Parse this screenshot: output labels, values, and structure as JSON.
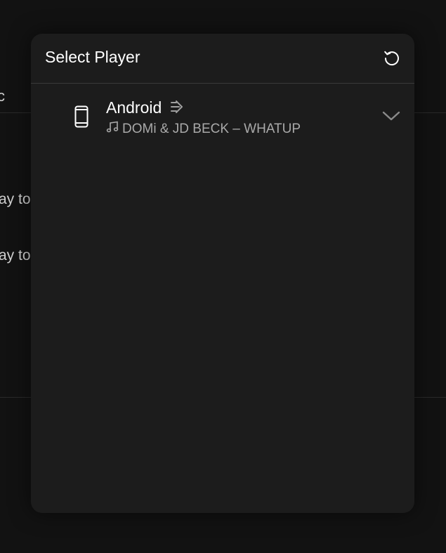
{
  "background": {
    "line_fragment_1": "ay to",
    "line_fragment_2": "ay to",
    "fragment_c": "c"
  },
  "modal": {
    "title": "Select Player",
    "refresh_icon": "refresh-icon",
    "players": [
      {
        "name": "Android",
        "device_icon": "phone-icon",
        "status_icon": "connect-arrow-icon",
        "now_playing_icon": "music-note-icon",
        "now_playing": "DOMi & JD BECK – WHATUP",
        "expand_icon": "chevron-down-icon"
      }
    ]
  },
  "colors": {
    "page_background": "#121212",
    "modal_background": "#1c1c1c",
    "divider": "#3a3a3a",
    "primary_text": "#ffffff",
    "secondary_text": "#a9a9a9"
  }
}
